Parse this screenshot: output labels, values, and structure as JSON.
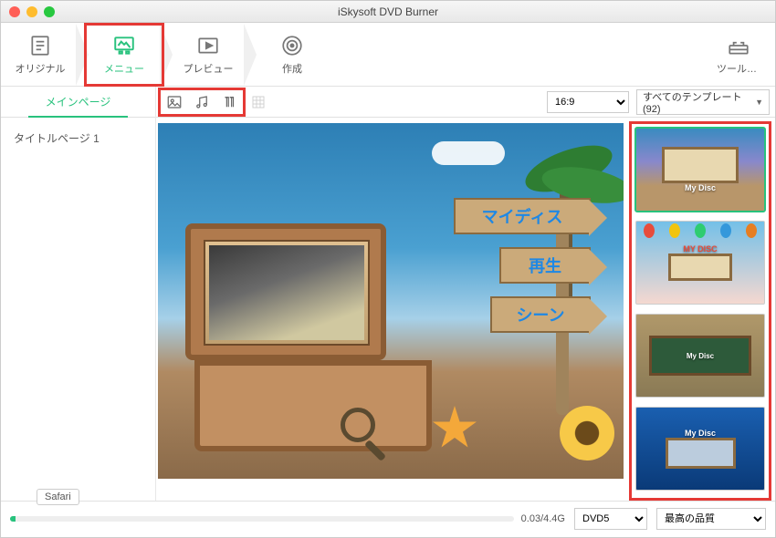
{
  "titlebar": {
    "title": "iSkysoft DVD Burner"
  },
  "steps": {
    "original": "オリジナル",
    "menu": "メニュー",
    "preview": "プレビュー",
    "create": "作成",
    "toolbox": "ツールボ…"
  },
  "subbar": {
    "mainpage_tab": "メインページ",
    "aspect_selected": "16:9",
    "templates_dropdown": "すべてのテンプレート(92)"
  },
  "sidebar": {
    "item1": "タイトルページ  1"
  },
  "canvas": {
    "sign1": "マイディス",
    "sign2": "再生",
    "sign3": "シーン"
  },
  "templates": {
    "t1": {
      "caption": "My Disc"
    },
    "t2": {
      "caption": "MY DISC"
    },
    "t3": {
      "caption": "My Disc"
    },
    "t4": {
      "caption": "My Disc"
    }
  },
  "footer": {
    "tooltip": "Safari",
    "progress_text": "0.03/4.4G",
    "dvd_type": "DVD5",
    "quality": "最高の品質"
  }
}
